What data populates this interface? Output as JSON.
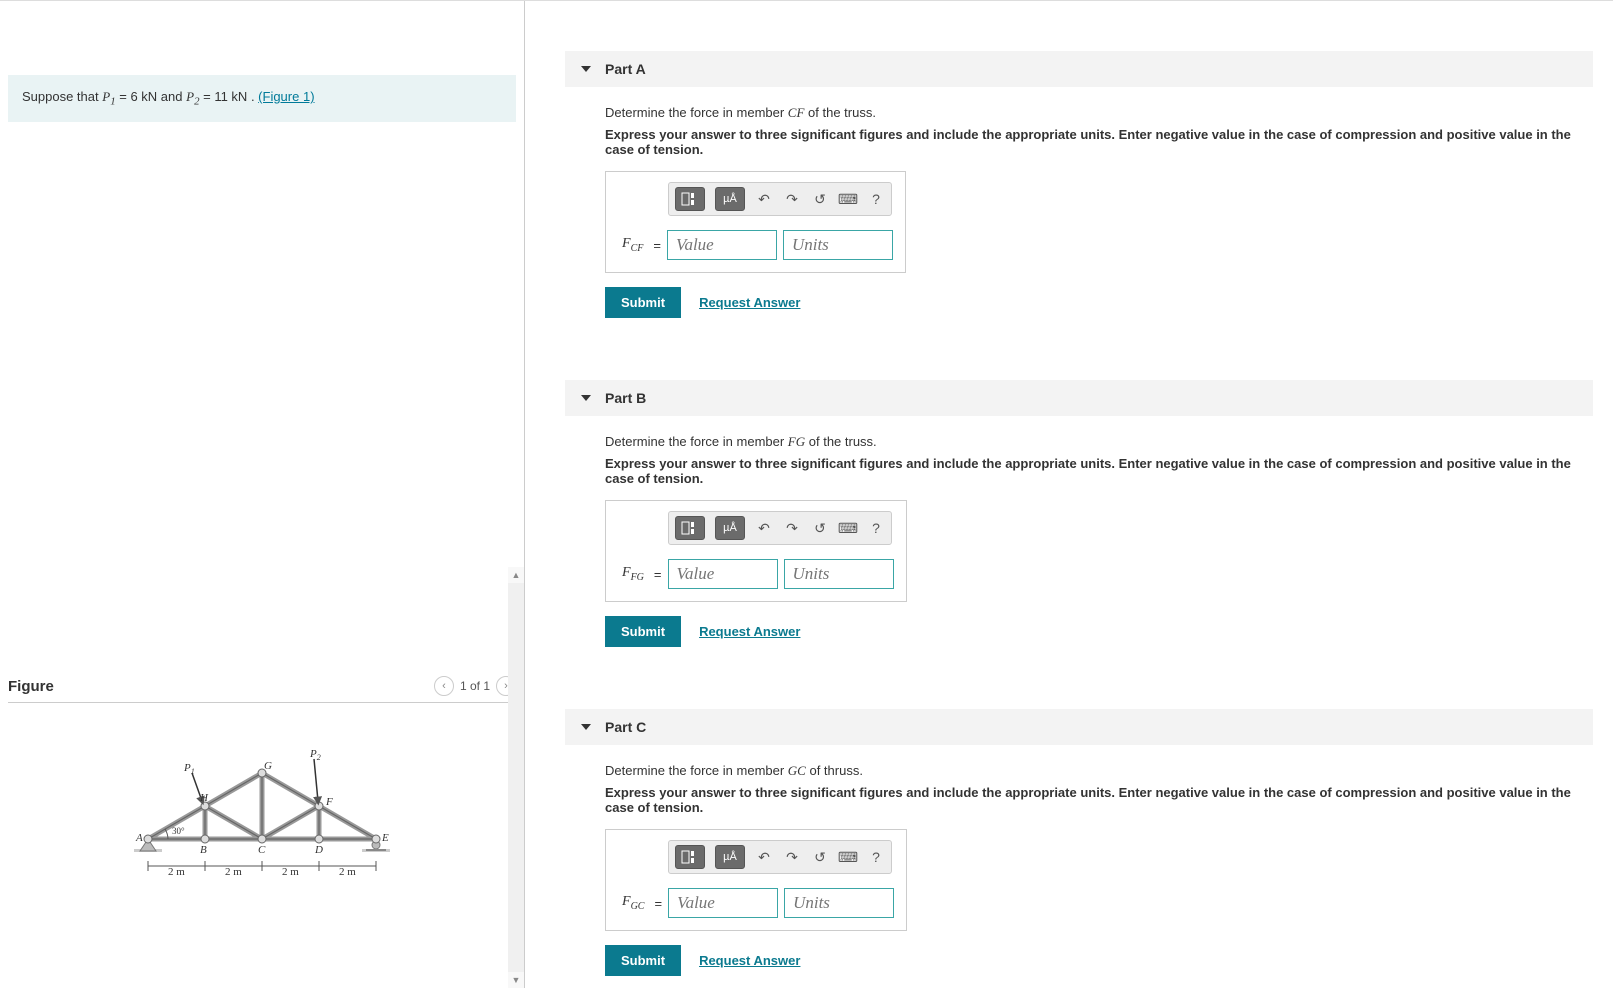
{
  "problem": {
    "prefix": "Suppose that ",
    "p1_var": "P",
    "p1_sub": "1",
    "p1_val": " = 6 kN",
    "and": " and ",
    "p2_var": "P",
    "p2_sub": "2",
    "p2_val": " = 11 kN",
    "suffix": ". ",
    "figure_link": "(Figure 1)"
  },
  "figure": {
    "title": "Figure",
    "counter": "1 of 1",
    "labels": {
      "P1": "P",
      "P1s": "1",
      "P2": "P",
      "P2s": "2",
      "A": "A",
      "B": "B",
      "C": "C",
      "D": "D",
      "E": "E",
      "F": "F",
      "G": "G",
      "H": "H",
      "angle": "30°",
      "span": "2 m"
    }
  },
  "common": {
    "instruct": "Express your answer to three significant figures and include the appropriate units. Enter negative value in the case of compression and positive value in the case of tension.",
    "value_ph": "Value",
    "units_ph": "Units",
    "submit": "Submit",
    "request": "Request Answer",
    "help_q": "?",
    "micro": "µÅ"
  },
  "parts": {
    "A": {
      "title": "Part A",
      "prompt_pre": "Determine the force in member ",
      "member": "CF",
      "prompt_post": " of the truss.",
      "var": "F",
      "sub": "CF"
    },
    "B": {
      "title": "Part B",
      "prompt_pre": "Determine the force in member ",
      "member": "FG",
      "prompt_post": " of the truss.",
      "var": "F",
      "sub": "FG"
    },
    "C": {
      "title": "Part C",
      "prompt_pre": "Determine the force in member ",
      "member": "GC",
      "prompt_post": " of thruss.",
      "var": "F",
      "sub": "GC"
    }
  }
}
